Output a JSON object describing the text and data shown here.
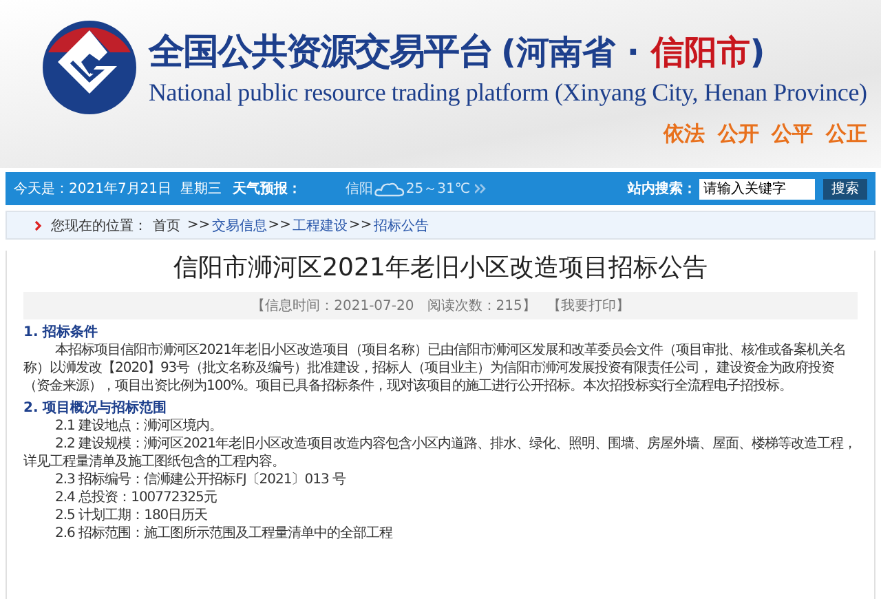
{
  "header": {
    "title": "全国公共资源交易平台",
    "region": [
      "(河南省 · ",
      "信阳市",
      ")"
    ],
    "subtitle": "National public resource trading platform (Xinyang City, Henan Province)",
    "slogan": "依法 公开 公平 公正"
  },
  "top_bar": {
    "date": "今天是：2021年7月21日  星期三",
    "weather_label": "天气预报：",
    "city": "信阳",
    "temperature": "25～31℃",
    "search_label": "站内搜索：",
    "search_value": "请输入关键字",
    "search_button": "搜索"
  },
  "breadcrumb": {
    "label": "您现在的位置：",
    "items": [
      "首页",
      "交易信息",
      "工程建设",
      "招标公告"
    ],
    "separator": ">>"
  },
  "article": {
    "title": "信阳市浉河区2021年老旧小区改造项目招标公告",
    "meta": "【信息时间：2021-07-20   阅读次数：215】",
    "print_link": "【我要打印】",
    "sections": [
      {
        "heading": "1.  招标条件",
        "paragraphs": [
          {
            "text": "本招标项目信阳市浉河区2021年老旧小区改造项目（项目名称）已由信阳市浉河区发展和改革委员会文件（项目审批、核准或备案机关名称）以浉发改【2020】93号（批文名称及编号）批准建设，招标人（项目业主）为信阳市浉河发展投资有限责任公司， 建设资金为政府投资（资金来源），项目出资比例为100%。项目已具备招标条件，现对该项目的施工进行公开招标。本次招投标实行全流程电子招投标。"
          }
        ]
      },
      {
        "heading": "2.  项目概况与招标范围",
        "paragraphs": [
          {
            "text": "2.1 建设地点：浉河区境内。"
          },
          {
            "text": "2.2 建设规模：浉河区2021年老旧小区改造项目改造内容包含小区内道路、排水、绿化、照明、围墙、房屋外墙、屋面、楼梯等改造工程，详见工程量清单及施工图纸包含的工程内容。"
          },
          {
            "text": "2.3 招标编号：信浉建公开招标FJ〔2021〕013 号"
          },
          {
            "text": "2.4 总投资：100772325元"
          },
          {
            "text": "2.5 计划工期：180日历天"
          },
          {
            "text": "2.6 招标范围：施工图所示范围及工程量清单中的全部工程"
          }
        ]
      }
    ]
  }
}
